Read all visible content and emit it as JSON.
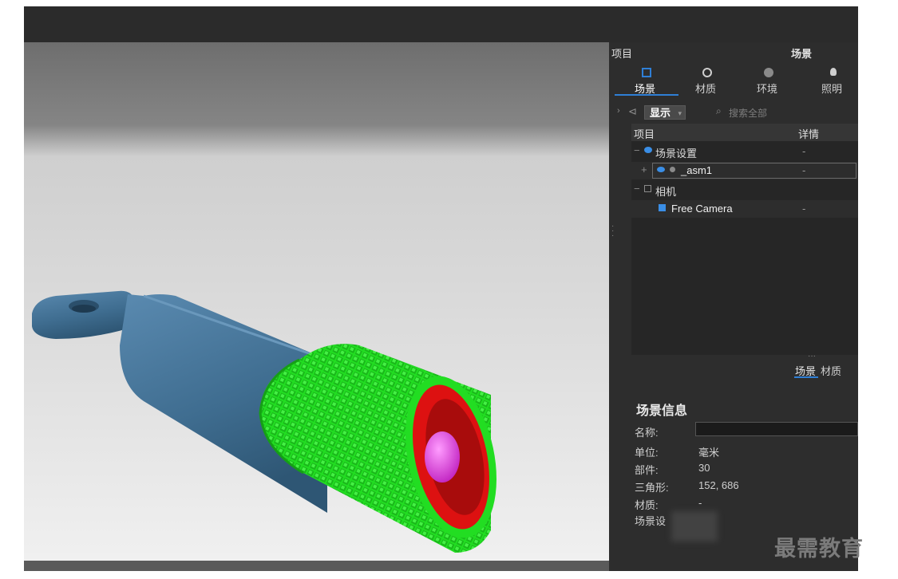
{
  "panel": {
    "header": {
      "left_title": "项目",
      "center_title": "场景"
    },
    "tabs": [
      {
        "label": "场景",
        "icon": "scene-icon",
        "active": true
      },
      {
        "label": "材质",
        "icon": "material-icon",
        "active": false
      },
      {
        "label": "环境",
        "icon": "environment-icon",
        "active": false
      },
      {
        "label": "照明",
        "icon": "lighting-icon",
        "active": false
      }
    ],
    "filter": {
      "show_label": "显示",
      "search_placeholder": "搜索全部"
    },
    "tree": {
      "columns": [
        "项目",
        "详情"
      ],
      "rows": [
        {
          "label": "场景设置",
          "detail": "-",
          "icon": "scene-settings-icon"
        },
        {
          "label": "_asm1",
          "detail": "-",
          "icon": "eye-icon"
        },
        {
          "label": "相机",
          "detail": "",
          "icon": "camera-icon"
        },
        {
          "label": "Free Camera",
          "detail": "-",
          "icon": "camera-icon"
        }
      ]
    },
    "mid_tabs": [
      {
        "label": "场景",
        "active": true
      },
      {
        "label": "材质",
        "active": false
      }
    ],
    "info": {
      "title": "场景信息",
      "name_label": "名称:",
      "unit_label": "单位:",
      "unit_value": "毫米",
      "parts_label": "部件:",
      "parts_value": "30",
      "triangles_label": "三角形:",
      "triangles_value": "152, 686",
      "materials_label": "材质:",
      "materials_value": "-",
      "scene_label": "场景设"
    }
  },
  "watermark": "最需教育",
  "colors": {
    "accent": "#2f7fd6",
    "body_blue": "#4a7a9e",
    "knurl_green": "#22dd22",
    "inner_red": "#dd1111",
    "tip_magenta": "#ee44ee"
  }
}
